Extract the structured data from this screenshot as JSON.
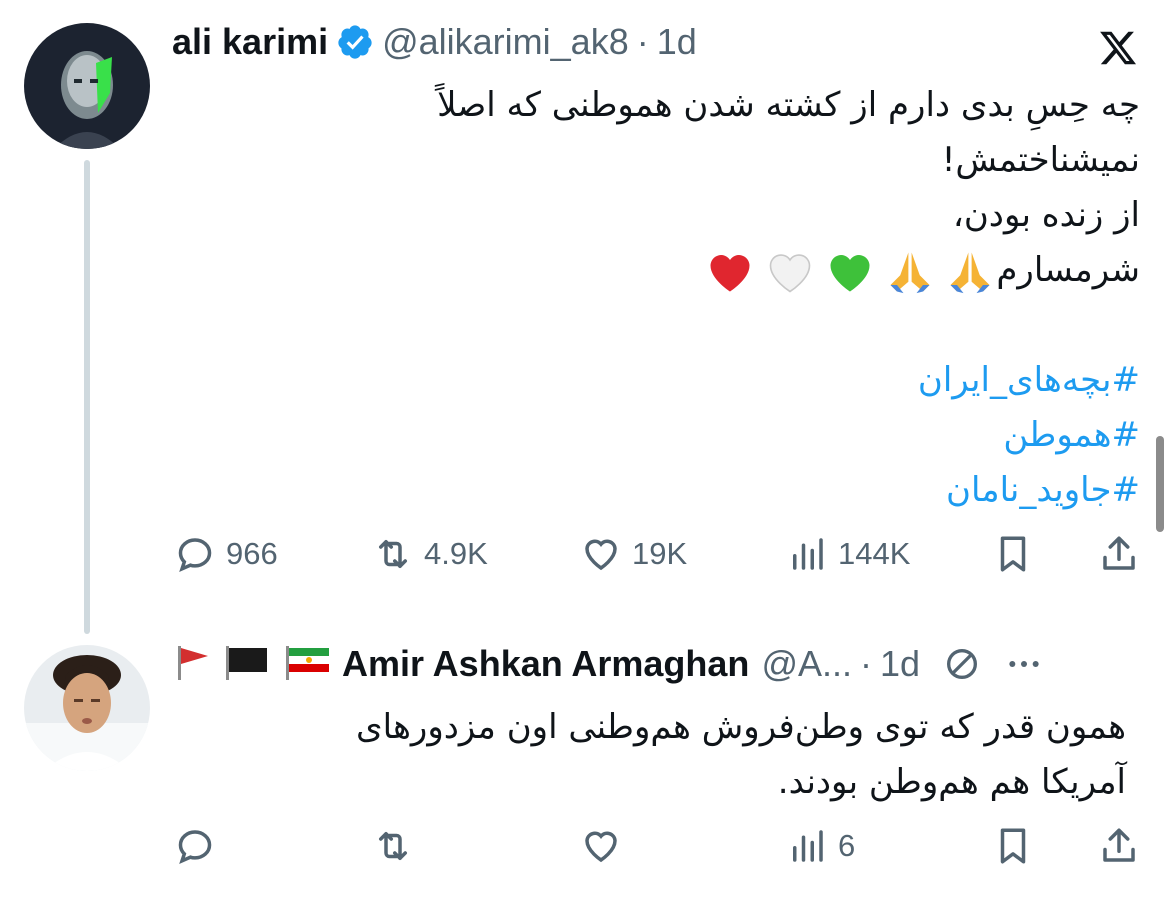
{
  "tweets": [
    {
      "author": {
        "name": "ali karimi",
        "handle": "@alikarimi_ak8",
        "verified": true
      },
      "separator": "·",
      "time": "1d",
      "text_lines": [
        "چه حِسِ بدی دارم از کشته شدن  هموطنی که اصلاً",
        "نمیشناختمش!",
        "از زنده بودن،",
        "شرمسارم"
      ],
      "emojis": [
        "folded-hands-emoji",
        "folded-hands-emoji",
        "green-heart-emoji",
        "white-heart-emoji",
        "red-heart-emoji"
      ],
      "hashtags": [
        "#بچه‌های_ایران",
        "#هموطن",
        "#جاوید_نامان"
      ],
      "stats": {
        "replies": "966",
        "reposts": "4.9K",
        "likes": "19K",
        "views": "144K"
      }
    },
    {
      "author": {
        "name": "Amir Ashkan Armaghan",
        "handle": "@A...",
        "flags": [
          "red-flag-icon",
          "black-flag-icon",
          "iran-lion-sun-flag-icon"
        ]
      },
      "separator": "·",
      "time": "1d",
      "text_lines": [
        "همون قدر که توی وطن‌فروش هم‌وطنی اون مزدورهای",
        "آمریکا هم هم‌وطن بودند."
      ],
      "stats": {
        "replies": "",
        "reposts": "",
        "likes": "",
        "views": "6"
      }
    }
  ],
  "colors": {
    "text": "#0f1419",
    "secondary": "#536471",
    "link": "#1d9bf0",
    "verified": "#1d9bf0",
    "thread_line": "#cfd9de"
  }
}
